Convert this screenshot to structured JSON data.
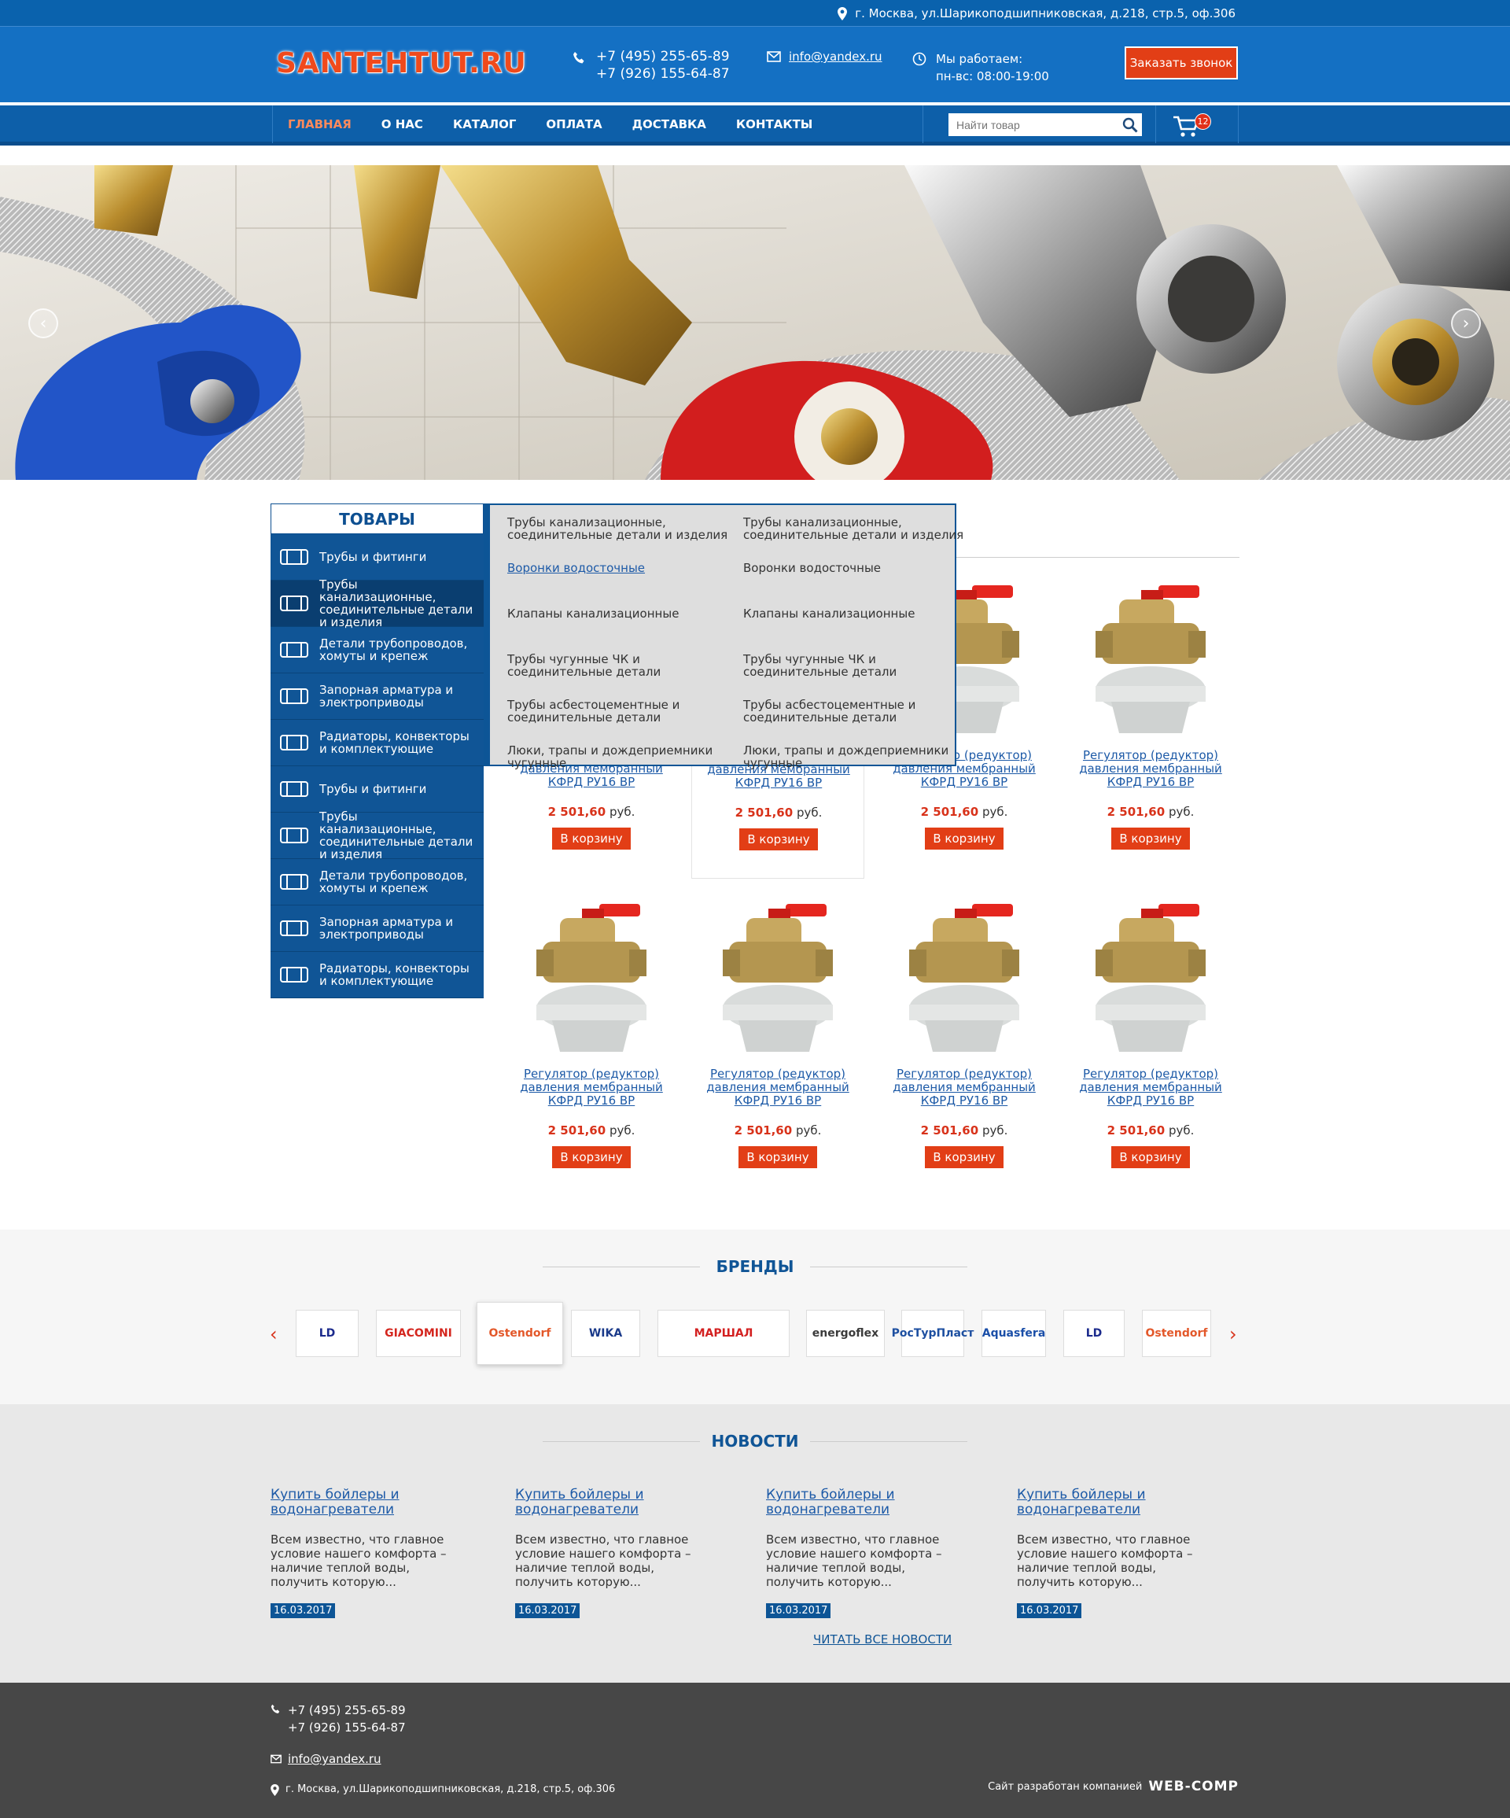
{
  "topbar": {
    "address": "г. Москва, ул.Шарикоподшипниковская, д.218, стр.5, оф.306"
  },
  "header": {
    "logo": "SANTEHTUT.RU",
    "phone1": "+7 (495) 255-65-89",
    "phone2": "+7 (926) 155-64-87",
    "email": "info@yandex.ru",
    "hours_label": "Мы работаем:",
    "hours": "пн-вс: 08:00-19:00",
    "callback_button": "Заказать звонок"
  },
  "nav": {
    "items": [
      "ГЛАВНАЯ",
      "О НАС",
      "КАТАЛОГ",
      "ОПЛАТА",
      "ДОСТАВКА",
      "КОНТАКТЫ"
    ],
    "search_placeholder": "Найти товар",
    "cart_count": "12"
  },
  "sidebar": {
    "title": "ТОВАРЫ",
    "items": [
      "Трубы и фитинги",
      "Трубы канализационные, соединительные детали и изделия",
      "Детали трубопроводов, хомуты и крепеж",
      "Запорная арматура и электроприводы",
      "Радиаторы, конвекторы и комплектующие",
      "Трубы и фитинги",
      "Трубы канализационные, соединительные детали и изделия",
      "Детали трубопроводов, хомуты и крепеж",
      "Запорная арматура и электроприводы",
      "Радиаторы, конвекторы и комплектующие"
    ]
  },
  "submenu": {
    "items": [
      "Трубы канализационные, соединительные детали и изделия",
      "Трубы канализационные, соединительные детали и изделия",
      "Воронки водосточные",
      "Воронки водосточные",
      "Клапаны канализационные",
      "Клапаны канализационные",
      "Трубы чугунные ЧК и соединительные детали",
      "Трубы чугунные ЧК и соединительные детали",
      "Трубы асбестоцементные и соединительные детали",
      "Трубы асбестоцементные и соединительные детали",
      "Люки, трапы и дождеприемники чугунные",
      "Люки, трапы и дождеприемники чугунные"
    ]
  },
  "products": {
    "name": "Регулятор (редуктор) давления мембранный КФРД РУ16 ВР",
    "name_partial": "давления мембранный КФРД РУ16 ВР",
    "price": "2 501,60",
    "currency": "руб.",
    "cart_button": "В корзину"
  },
  "brands": {
    "title": "БРЕНДЫ",
    "items": [
      "LD",
      "GIACOMINI",
      "Ostendorf",
      "WIKA",
      "МАРШАЛ",
      "energoflex",
      "РосТурПласт",
      "Aquasfera",
      "LD",
      "Ostendorf"
    ]
  },
  "news": {
    "title": "НОВОСТИ",
    "item_title": "Купить бойлеры и водонагреватели",
    "item_text": "Всем известно, что главное условие нашего комфорта – наличие теплой воды, получить которую...",
    "item_date": "16.03.2017",
    "all_news": "ЧИТАТЬ ВСЕ НОВОСТИ"
  },
  "footer": {
    "phone1": "+7 (495) 255-65-89",
    "phone2": "+7 (926) 155-64-87",
    "email": "info@yandex.ru",
    "address": "г. Москва, ул.Шарикоподшипниковская, д.218, стр.5, оф.306",
    "dev_text": "Сайт разработан компанией",
    "dev_company": "WEB-COMP"
  },
  "colors": {
    "primary": "#1470c3",
    "accent": "#e23e16",
    "dark": "#105596"
  }
}
